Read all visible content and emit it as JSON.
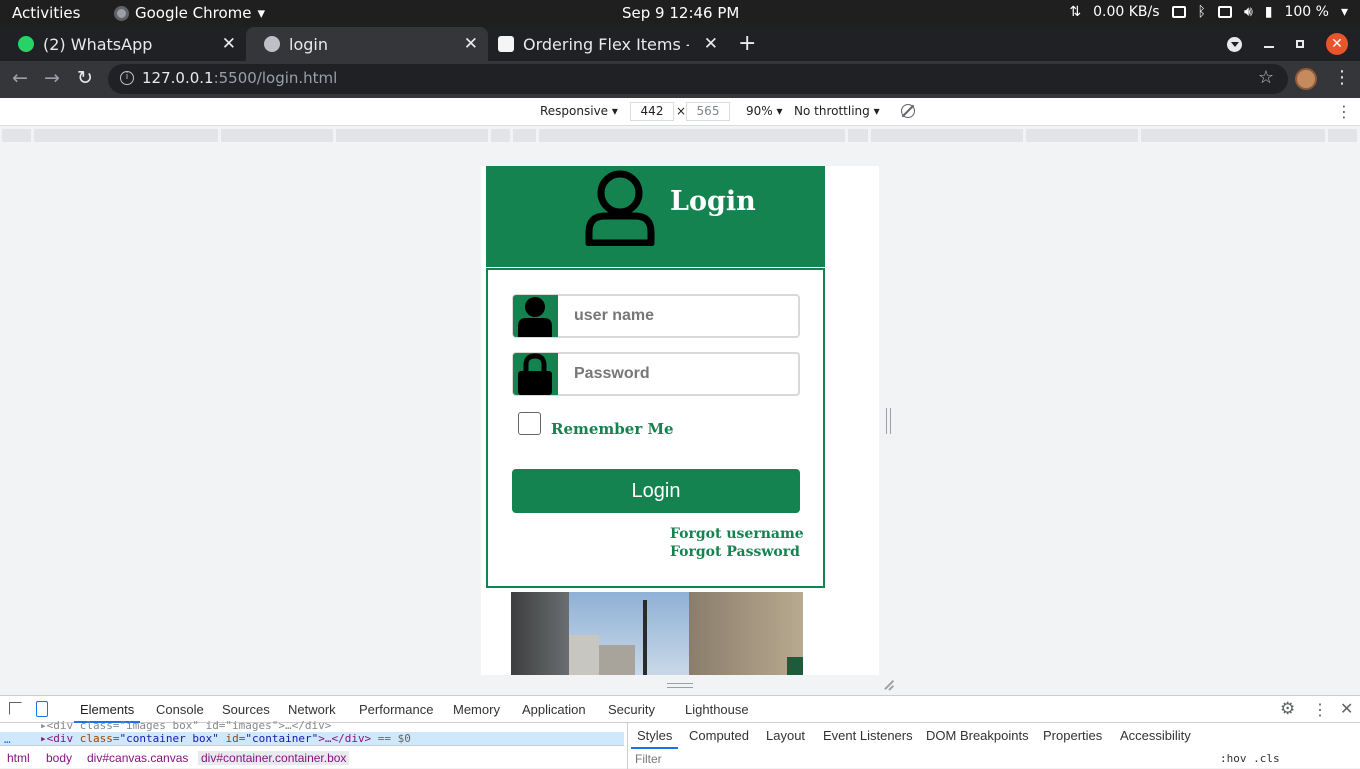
{
  "system_bar": {
    "activities": "Activities",
    "app_name": "Google Chrome",
    "clock": "Sep 9  12:46 PM",
    "net_speed": "0.00 KB/s",
    "battery": "100 %"
  },
  "browser": {
    "tabs": [
      {
        "title": "(2) WhatsApp",
        "favicon_color": "#25d366"
      },
      {
        "title": "login",
        "favicon_color": "#bdc1c6"
      },
      {
        "title": "Ordering Flex Items - C",
        "favicon_color": "#f5f5f5"
      }
    ],
    "url_host": "127.0.0.1",
    "url_path": ":5500/login.html"
  },
  "device_toolbar": {
    "mode": "Responsive",
    "width": "442",
    "height": "565",
    "zoom": "90%",
    "throttling": "No throttling"
  },
  "page": {
    "header_title": "Login",
    "username_placeholder": "user name",
    "password_placeholder": "Password",
    "remember_label": "Remember Me",
    "login_button": "Login",
    "forgot_username": "Forgot username",
    "forgot_password": "Forgot Password",
    "accent_color": "#148350"
  },
  "devtools": {
    "tabs": [
      "Elements",
      "Console",
      "Sources",
      "Network",
      "Performance",
      "Memory",
      "Application",
      "Security",
      "Lighthouse"
    ],
    "dom_line_1": "<div class=\"images box\" id=\"images\">…</div>",
    "dom_line_2_tag": "<div ",
    "dom_line_2_attr1": "class=",
    "dom_line_2_val1": "\"container box\"",
    "dom_line_2_attr2": " id=",
    "dom_line_2_val2": "\"container\"",
    "dom_line_2_rest": ">…</div>",
    "dom_line_2_sel": " == $0",
    "breadcrumbs": [
      "html",
      "body",
      "div#canvas.canvas",
      "div#container.container.box"
    ],
    "side_tabs": [
      "Styles",
      "Computed",
      "Layout",
      "Event Listeners",
      "DOM Breakpoints",
      "Properties",
      "Accessibility"
    ],
    "filter_placeholder": "Filter",
    "hov_cls": ":hov  .cls"
  }
}
